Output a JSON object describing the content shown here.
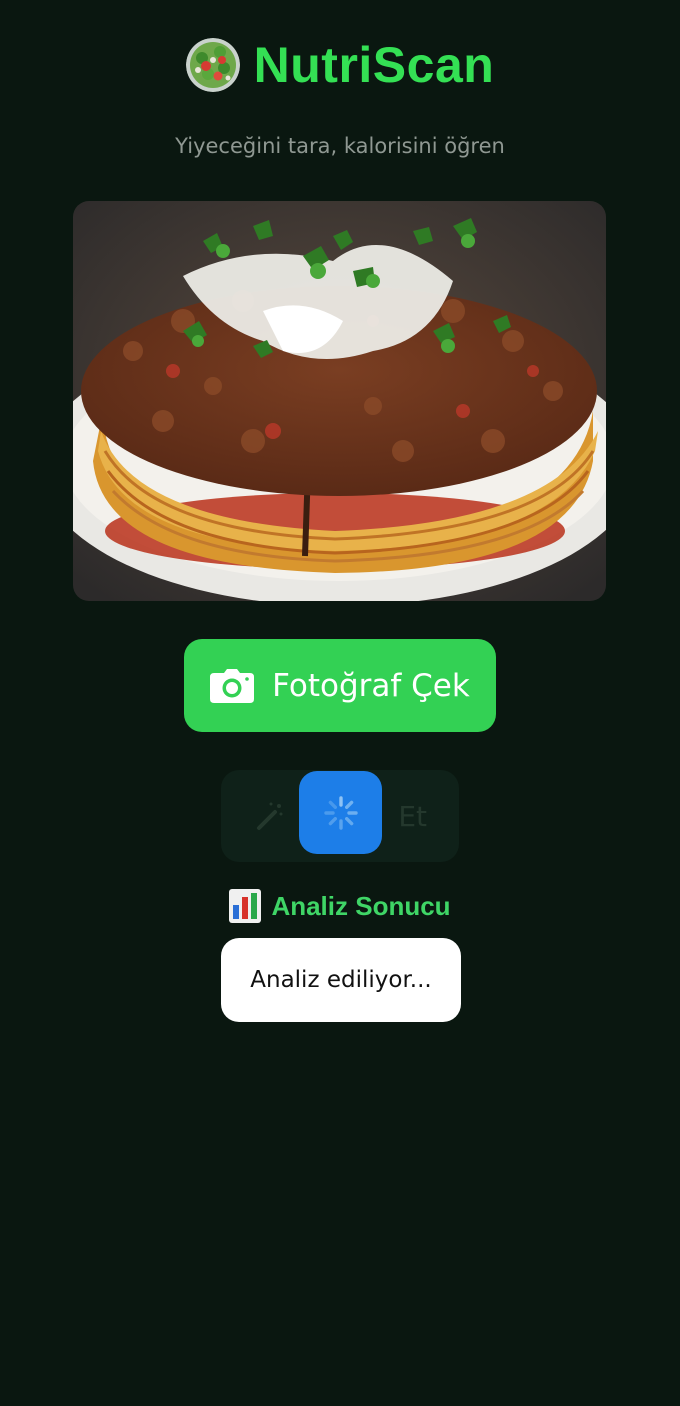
{
  "app": {
    "title": "NutriScan",
    "subtitle": "Yiyeceğini tara, kalorisini öğren",
    "logo_icon": "salad-bowl-icon"
  },
  "photo": {
    "subject": "food-photo",
    "alt": "Kıymalı lavaş katmanlı yemek"
  },
  "buttons": {
    "take_photo_label": "Fotoğraf Çek",
    "take_photo_icon": "camera-icon",
    "analyze_label_partial": "Et",
    "analyze_icon": "magic-wand-icon",
    "loading_icon": "spinner-icon"
  },
  "result": {
    "icon": "bar-chart-icon",
    "title": "Analiz Sonucu",
    "status": "Analiz ediliyor..."
  },
  "colors": {
    "background": "#0a1710",
    "accent_green": "#34e054",
    "button_green": "#33d154",
    "spinner_blue": "#1d7ee8",
    "subtitle_gray": "#8f9892"
  }
}
